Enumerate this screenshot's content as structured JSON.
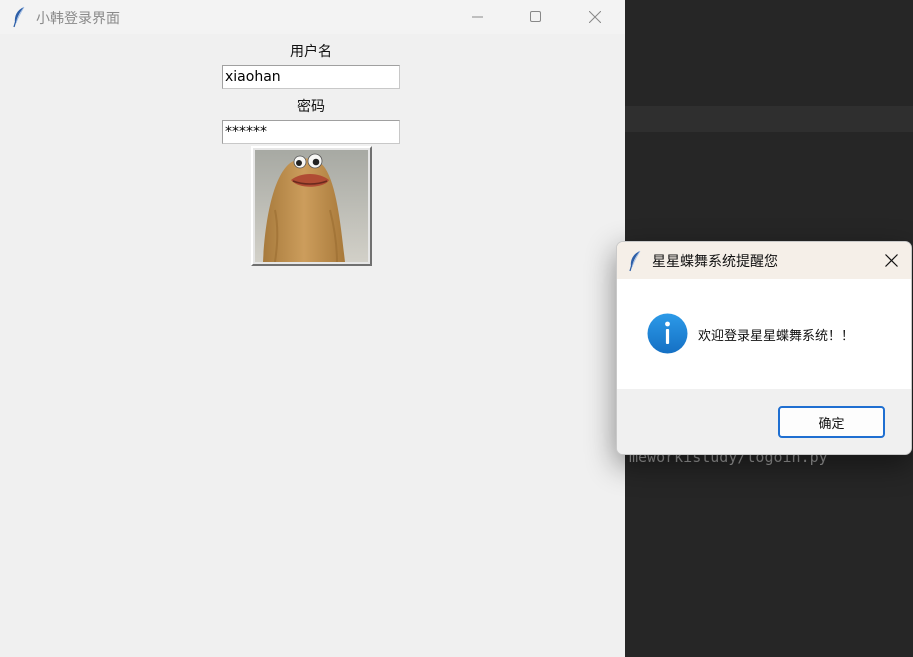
{
  "editor": {
    "path_text": "meworkistudy/logoin.py"
  },
  "main_window": {
    "title": "小韩登录界面",
    "username_label": "用户名",
    "username_value": "xiaohan",
    "password_label": "密码",
    "password_value": "******"
  },
  "dialog": {
    "title": "星星蝶舞系统提醒您",
    "message": "欢迎登录星星蝶舞系统！！",
    "ok_label": "确定"
  },
  "colors": {
    "accent": "#1f6fd1",
    "info_icon": "#1e88d8",
    "dialog_titlebar": "#f5efe8",
    "window_bg": "#f0f0f0"
  },
  "icons": [
    "feather-icon",
    "minimize-icon",
    "maximize-icon",
    "close-icon",
    "info-icon"
  ]
}
